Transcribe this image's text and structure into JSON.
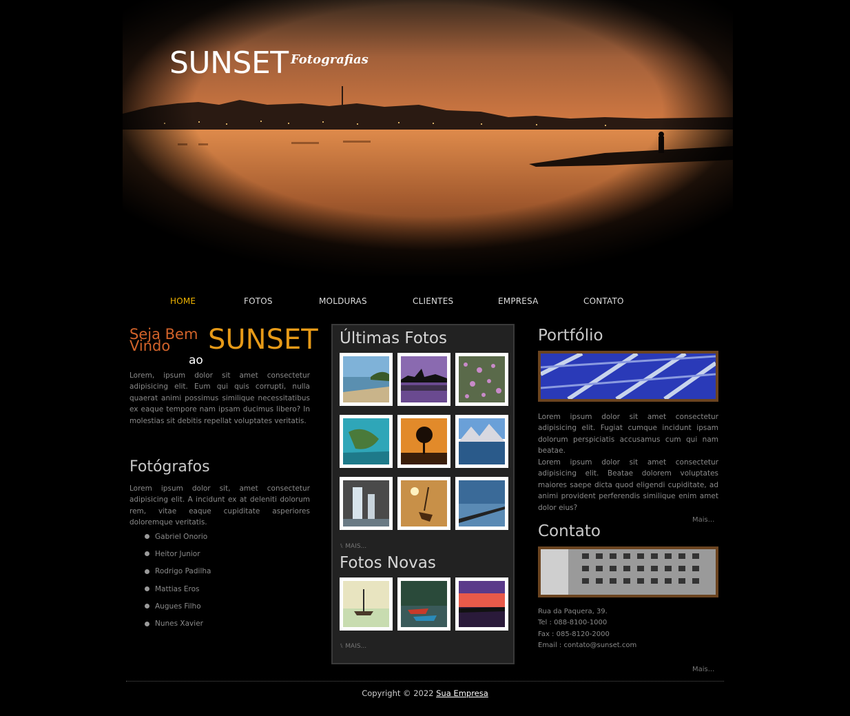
{
  "header": {
    "logo_main": "SUNSET",
    "logo_sub": "Fotografias"
  },
  "nav": {
    "items": [
      {
        "label": "HOME",
        "active": true
      },
      {
        "label": "FOTOS",
        "active": false
      },
      {
        "label": "MOLDURAS",
        "active": false
      },
      {
        "label": "CLIENTES",
        "active": false
      },
      {
        "label": "EMPRESA",
        "active": false
      },
      {
        "label": "CONTATO",
        "active": false
      }
    ]
  },
  "welcome": {
    "line1": "Seja Bem Vindo",
    "ao": "ao",
    "brand": "SUNSET",
    "text": "Lorem, ipsum dolor sit amet consectetur adipisicing elit. Eum qui quis corrupti, nulla quaerat animi possimus similique necessitatibus ex eaque tempore nam ipsam ducimus libero? In molestias sit debitis repellat voluptates veritatis."
  },
  "fotografos": {
    "title": "Fotógrafos",
    "text": "Lorem ipsum dolor sit, amet consectetur adipisicing elit. A incidunt ex at deleniti dolorum rem, vitae eaque cupiditate asperiores doloremque veritatis.",
    "names": [
      "Gabriel Onorio",
      "Heitor Junior",
      "Rodrigo Padilha",
      "Mattias Eros",
      "Augues Filho",
      "Nunes Xavier"
    ]
  },
  "gallery": {
    "ultimas_title": "Últimas Fotos",
    "ultimas_more": "MAIS...",
    "novas_title": "Fotos Novas",
    "novas_more": "MAIS...",
    "ultimas_icons": [
      "beach-photo-icon",
      "lake-sunset-photo-icon",
      "flowers-photo-icon",
      "island-photo-icon",
      "tree-sunset-photo-icon",
      "mountain-lake-photo-icon",
      "waterfall-photo-icon",
      "boat-sunset-photo-icon",
      "pier-photo-icon"
    ],
    "novas_icons": [
      "boat-lake-photo-icon",
      "canoes-photo-icon",
      "red-sunset-photo-icon"
    ]
  },
  "portfolio": {
    "title": "Portfólio",
    "text1": "Lorem ipsum dolor sit amet consectetur adipisicing elit. Fugiat cumque incidunt ipsam dolorum perspiciatis accusamus cum qui nam beatae.",
    "text2": "Lorem ipsum dolor sit amet consectetur adipisicing elit. Beatae dolorem voluptates maiores saepe dicta quod eligendi cupiditate, ad animi provident perferendis similique enim amet dolor eius?",
    "more": "Mais..."
  },
  "contato": {
    "title": "Contato",
    "address": "Rua da Paquera, 39.",
    "tel": "Tel : 088-8100-1000",
    "fax": "Fax : 085-8120-2000",
    "email": "Email : contato@sunset.com",
    "more": "Mais..."
  },
  "footer": {
    "copyright": "Copyright © 2022",
    "company": "Sua Empresa"
  },
  "colors": {
    "accent": "#f0b400",
    "welcome_orange": "#d2632a",
    "brand_gold": "#e69a18",
    "frame_brown": "#6b4420"
  }
}
